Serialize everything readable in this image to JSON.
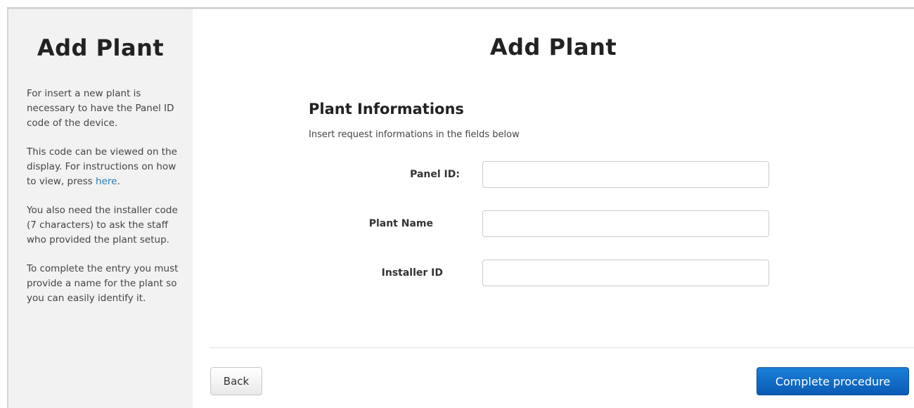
{
  "sidebar": {
    "title": "Add Plant",
    "paragraph_1": "For insert a new plant is necessary to have the Panel ID code of the device.",
    "paragraph_2_before_link": "This code can be viewed on the display. For instructions on how to view, press ",
    "paragraph_2_link": "here",
    "paragraph_2_after_link": ".",
    "paragraph_3": "You also need the installer code (7 characters) to ask the staff who provided the plant setup.",
    "paragraph_4": "To complete the entry you must provide a name for the plant so you can easily identify it."
  },
  "main": {
    "title": "Add Plant",
    "section_title": "Plant Informations",
    "section_subtitle": "Insert request informations in the fields below",
    "fields": [
      {
        "label": "Panel ID:",
        "value": "",
        "placeholder": ""
      },
      {
        "label": "Plant Name",
        "value": "",
        "placeholder": ""
      },
      {
        "label": "Installer ID",
        "value": "",
        "placeholder": ""
      }
    ]
  },
  "footer": {
    "back_label": "Back",
    "complete_label": "Complete procedure"
  },
  "colors": {
    "link": "#2a7ab8",
    "primary_button": "#0a5bb5",
    "sidebar_bg": "#f2f2f2"
  }
}
